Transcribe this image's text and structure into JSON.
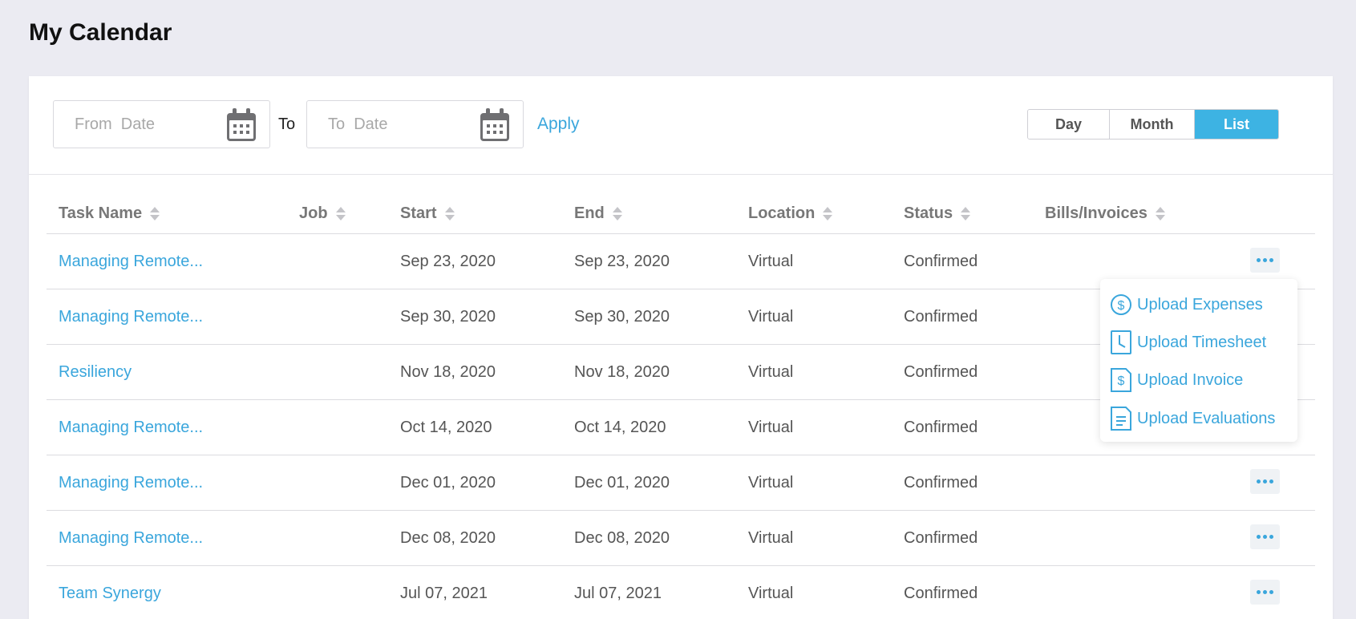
{
  "page": {
    "title": "My Calendar"
  },
  "filters": {
    "from_placeholder": "From  Date",
    "to_label": "To",
    "to_placeholder": "To  Date",
    "apply_label": "Apply"
  },
  "view_toggle": {
    "options": [
      "Day",
      "Month",
      "List"
    ],
    "active": "List"
  },
  "table": {
    "columns": [
      "Task Name",
      "Job",
      "Start",
      "End",
      "Location",
      "Status",
      "Bills/Invoices"
    ],
    "rows": [
      {
        "task": "Managing Remote...",
        "job": "",
        "start": "Sep 23, 2020",
        "end": "Sep 23, 2020",
        "location": "Virtual",
        "status": "Confirmed",
        "bills": ""
      },
      {
        "task": "Managing Remote...",
        "job": "",
        "start": "Sep 30, 2020",
        "end": "Sep 30, 2020",
        "location": "Virtual",
        "status": "Confirmed",
        "bills": ""
      },
      {
        "task": "Resiliency",
        "job": "",
        "start": "Nov 18, 2020",
        "end": "Nov 18, 2020",
        "location": "Virtual",
        "status": "Confirmed",
        "bills": ""
      },
      {
        "task": "Managing Remote...",
        "job": "",
        "start": "Oct 14, 2020",
        "end": "Oct 14, 2020",
        "location": "Virtual",
        "status": "Confirmed",
        "bills": ""
      },
      {
        "task": "Managing Remote...",
        "job": "",
        "start": "Dec 01, 2020",
        "end": "Dec 01, 2020",
        "location": "Virtual",
        "status": "Confirmed",
        "bills": ""
      },
      {
        "task": "Managing Remote...",
        "job": "",
        "start": "Dec 08, 2020",
        "end": "Dec 08, 2020",
        "location": "Virtual",
        "status": "Confirmed",
        "bills": ""
      },
      {
        "task": "Team Synergy",
        "job": "",
        "start": "Jul 07, 2021",
        "end": "Jul 07, 2021",
        "location": "Virtual",
        "status": "Confirmed",
        "bills": ""
      }
    ]
  },
  "row_menu": {
    "items": [
      {
        "label": "Upload Expenses",
        "icon": "dollar-circle-icon"
      },
      {
        "label": "Upload Timesheet",
        "icon": "timesheet-icon"
      },
      {
        "label": "Upload Invoice",
        "icon": "invoice-icon"
      },
      {
        "label": "Upload Evaluations",
        "icon": "evaluation-document-icon"
      }
    ]
  },
  "colors": {
    "accent": "#3db3e3",
    "link": "#3aa6dc",
    "background": "#ebebf2"
  }
}
